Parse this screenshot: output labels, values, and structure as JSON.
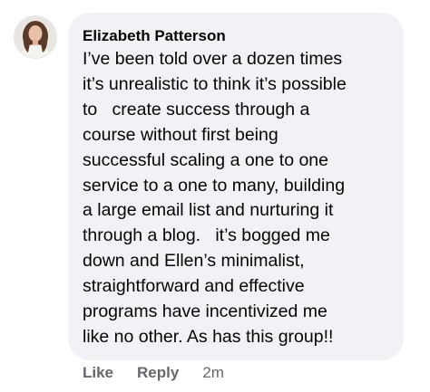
{
  "comment": {
    "author": "Elizabeth Patterson",
    "text": "I’ve been told over a dozen times\nit’s unrealistic to think it’s possible\nto   create success through a\ncourse without first being\nsuccessful scaling a one to one\nservice to a one to many, building\na large email list and nurturing it\nthrough a blog.   it’s bogged me\ndown and Ellen’s minimalist,\nstraightforward and effective\nprograms have incentivized me\nlike no other. As has this group!!",
    "actions": {
      "like_label": "Like",
      "reply_label": "Reply",
      "timestamp": "2m"
    }
  },
  "colors": {
    "bubble_background": "#f0f2f5",
    "action_text": "#65676b",
    "body_text": "#050505"
  }
}
